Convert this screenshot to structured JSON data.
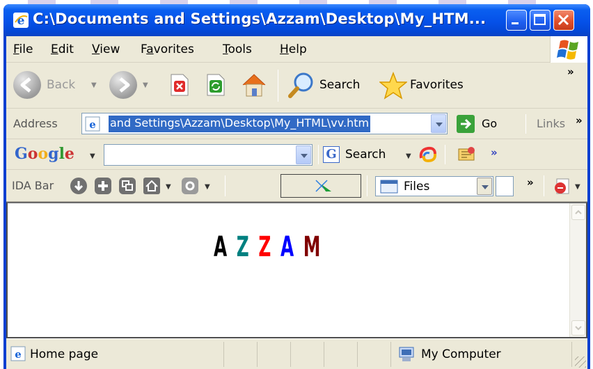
{
  "window": {
    "title": "C:\\Documents and Settings\\Azzam\\Desktop\\My_HTM...",
    "controls": [
      "minimize",
      "maximize",
      "close"
    ]
  },
  "menubar": {
    "items": [
      {
        "label": "File",
        "accel": "F",
        "rest": "ile"
      },
      {
        "label": "Edit",
        "accel": "E",
        "rest": "dit"
      },
      {
        "label": "View",
        "accel": "V",
        "rest": "iew"
      },
      {
        "label": "Favorites",
        "accel": "a",
        "pre": "F",
        "rest": "vorites"
      },
      {
        "label": "Tools",
        "accel": "T",
        "rest": "ools"
      },
      {
        "label": "Help",
        "accel": "H",
        "rest": "elp"
      }
    ]
  },
  "toolbar": {
    "back_label": "Back",
    "search_label": "Search",
    "favorites_label": "Favorites",
    "more_chevron": "»"
  },
  "address": {
    "label": "Address",
    "value": "and Settings\\Azzam\\Desktop\\My_HTML\\vv.htm",
    "go_label": "Go",
    "links_label": "Links",
    "more_chevron": "»"
  },
  "google": {
    "logo": "Google",
    "search_value": "",
    "search_button": "Search",
    "more_chevron": "»"
  },
  "ida": {
    "label": "IDA Bar",
    "files_label": "Files",
    "more_chevron": "»"
  },
  "content": {
    "letters": [
      {
        "char": "A",
        "color": "#000000"
      },
      {
        "char": "Z",
        "color": "#008080"
      },
      {
        "char": "Z",
        "color": "#ff0000"
      },
      {
        "char": "A",
        "color": "#0000ff"
      },
      {
        "char": "M",
        "color": "#800000"
      }
    ]
  },
  "status": {
    "text": "Home page",
    "zone": "My Computer"
  },
  "colors": {
    "titlebar": "#0a5ff0",
    "chrome": "#ece9d8",
    "selection": "#316ac5"
  }
}
